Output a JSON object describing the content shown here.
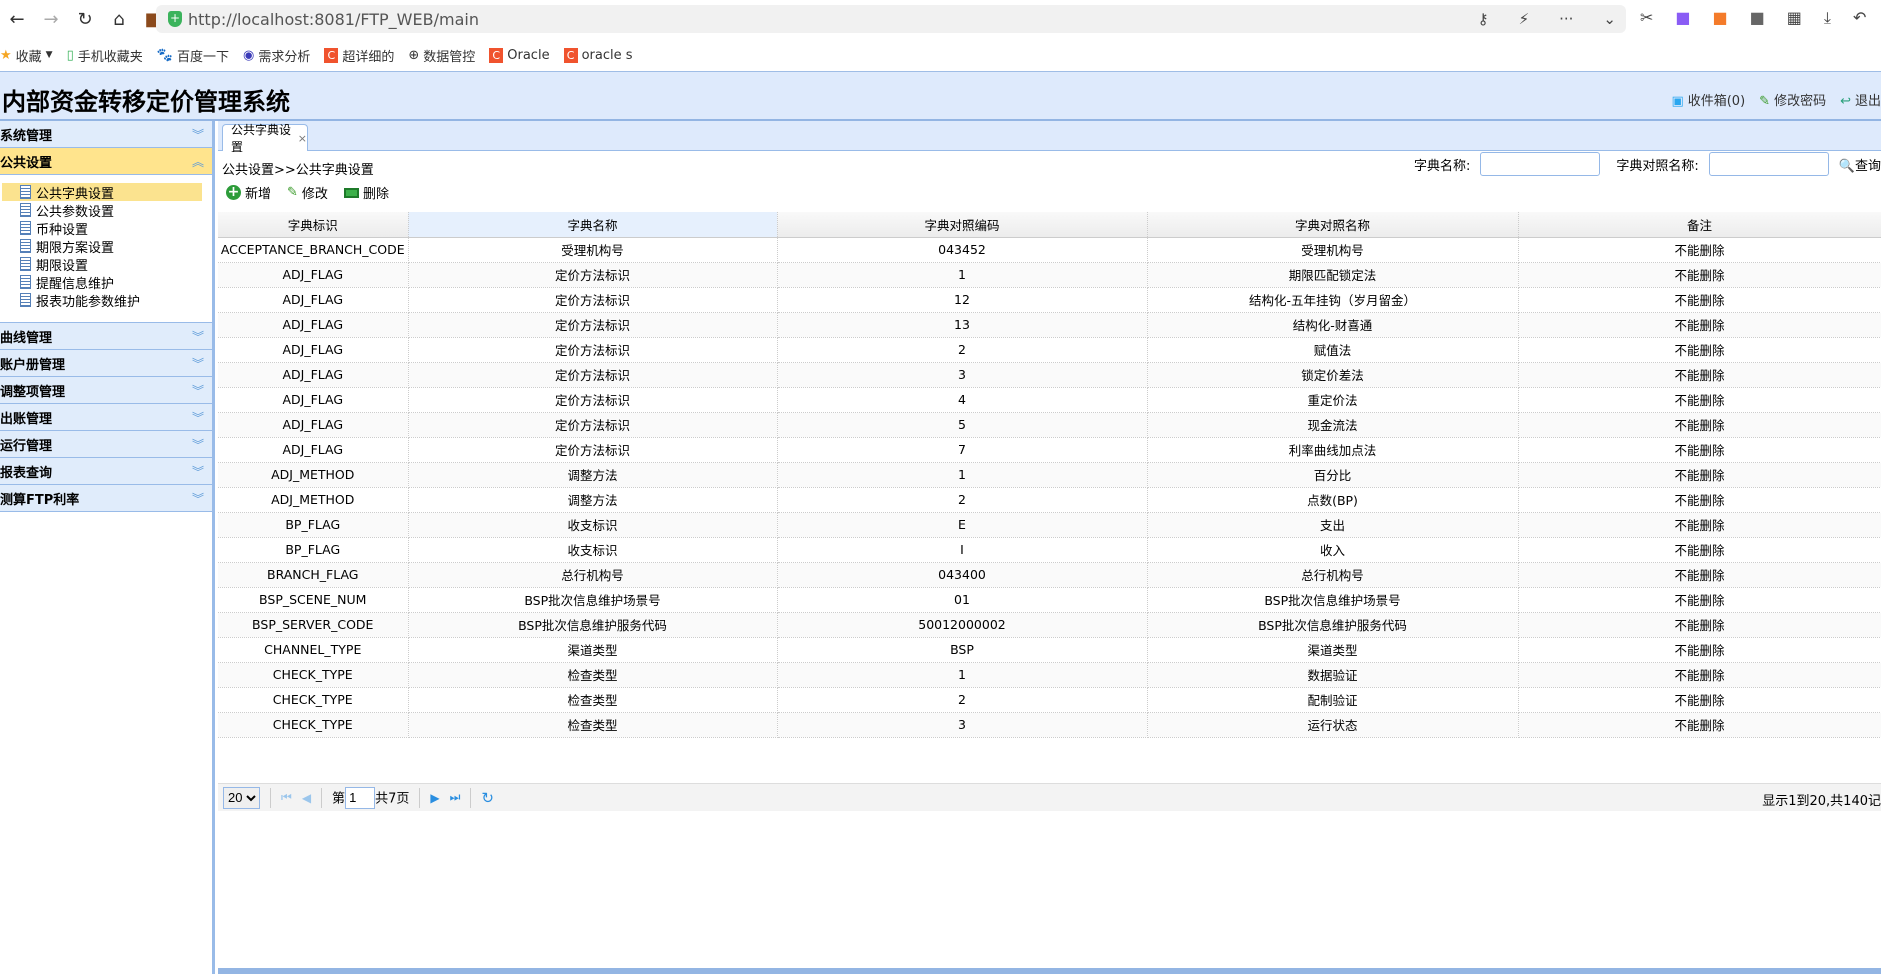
{
  "browser": {
    "url": "http://localhost:8081/FTP_WEB/main",
    "bookmarks": [
      {
        "label": "收藏",
        "icon": "star-icon"
      },
      {
        "label": "手机收藏夹",
        "icon": "phone-icon"
      },
      {
        "label": "百度一下",
        "icon": "baidu-icon"
      },
      {
        "label": "需求分析",
        "icon": "site-icon"
      },
      {
        "label": "超详细的",
        "icon": "csdn-icon"
      },
      {
        "label": "数据管控",
        "icon": "globe-icon"
      },
      {
        "label": "Oracle",
        "icon": "csdn-icon"
      },
      {
        "label": "oracle s",
        "icon": "csdn-icon"
      }
    ]
  },
  "header": {
    "title": "内部资金转移定价管理系统",
    "inbox": "收件箱(0)",
    "change_password": "修改密码",
    "logout": "退出"
  },
  "sidebar": {
    "panels": [
      {
        "label": "系统管理"
      },
      {
        "label": "公共设置",
        "active": true
      },
      {
        "label": "曲线管理"
      },
      {
        "label": "账户册管理"
      },
      {
        "label": "调整项管理"
      },
      {
        "label": "出账管理"
      },
      {
        "label": "运行管理"
      },
      {
        "label": "报表查询"
      },
      {
        "label": "测算FTP利率"
      }
    ],
    "tree": [
      "公共字典设置",
      "公共参数设置",
      "币种设置",
      "期限方案设置",
      "期限设置",
      "提醒信息维护",
      "报表功能参数维护"
    ]
  },
  "tab": {
    "label": "公共字典设置"
  },
  "breadcrumb": "公共设置>>公共字典设置",
  "toolbar": {
    "add": "新增",
    "edit": "修改",
    "delete": "删除"
  },
  "search": {
    "dict_name_label": "字典名称:",
    "dict_name_value": "",
    "map_name_label": "字典对照名称:",
    "map_name_value": "",
    "query": "查询"
  },
  "table": {
    "columns": [
      "字典标识",
      "字典名称",
      "字典对照编码",
      "字典对照名称",
      "备注"
    ],
    "rows": [
      [
        "ACCEPTANCE_BRANCH_CODE",
        "受理机构号",
        "043452",
        "受理机构号",
        "不能删除"
      ],
      [
        "ADJ_FLAG",
        "定价方法标识",
        "1",
        "期限匹配锁定法",
        "不能删除"
      ],
      [
        "ADJ_FLAG",
        "定价方法标识",
        "12",
        "结构化-五年挂钩（岁月留金）",
        "不能删除"
      ],
      [
        "ADJ_FLAG",
        "定价方法标识",
        "13",
        "结构化-财喜通",
        "不能删除"
      ],
      [
        "ADJ_FLAG",
        "定价方法标识",
        "2",
        "赋值法",
        "不能删除"
      ],
      [
        "ADJ_FLAG",
        "定价方法标识",
        "3",
        "锁定价差法",
        "不能删除"
      ],
      [
        "ADJ_FLAG",
        "定价方法标识",
        "4",
        "重定价法",
        "不能删除"
      ],
      [
        "ADJ_FLAG",
        "定价方法标识",
        "5",
        "现金流法",
        "不能删除"
      ],
      [
        "ADJ_FLAG",
        "定价方法标识",
        "7",
        "利率曲线加点法",
        "不能删除"
      ],
      [
        "ADJ_METHOD",
        "调整方法",
        "1",
        "百分比",
        "不能删除"
      ],
      [
        "ADJ_METHOD",
        "调整方法",
        "2",
        "点数(BP)",
        "不能删除"
      ],
      [
        "BP_FLAG",
        "收支标识",
        "E",
        "支出",
        "不能删除"
      ],
      [
        "BP_FLAG",
        "收支标识",
        "I",
        "收入",
        "不能删除"
      ],
      [
        "BRANCH_FLAG",
        "总行机构号",
        "043400",
        "总行机构号",
        "不能删除"
      ],
      [
        "BSP_SCENE_NUM",
        "BSP批次信息维护场景号",
        "01",
        "BSP批次信息维护场景号",
        "不能删除"
      ],
      [
        "BSP_SERVER_CODE",
        "BSP批次信息维护服务代码",
        "50012000002",
        "BSP批次信息维护服务代码",
        "不能删除"
      ],
      [
        "CHANNEL_TYPE",
        "渠道类型",
        "BSP",
        "渠道类型",
        "不能删除"
      ],
      [
        "CHECK_TYPE",
        "检查类型",
        "1",
        "数据验证",
        "不能删除"
      ],
      [
        "CHECK_TYPE",
        "检查类型",
        "2",
        "配制验证",
        "不能删除"
      ],
      [
        "CHECK_TYPE",
        "检查类型",
        "3",
        "运行状态",
        "不能删除"
      ]
    ]
  },
  "pager": {
    "page_size": "20",
    "page_prefix": "第",
    "page": "1",
    "page_total": "共7页",
    "info": "显示1到20,共140记"
  }
}
